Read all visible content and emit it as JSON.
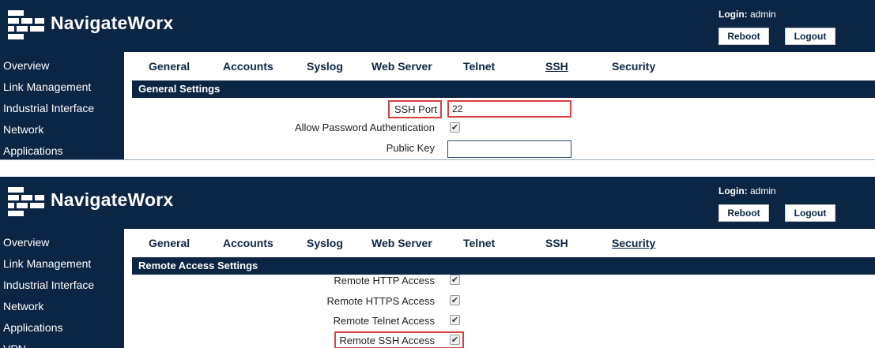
{
  "brand": "NavigateWorx",
  "login": {
    "label": "Login:",
    "user": "admin"
  },
  "buttons": {
    "reboot": "Reboot",
    "logout": "Logout"
  },
  "colors": {
    "navy": "#0b2545",
    "highlight": "#d84040"
  },
  "panel1": {
    "sidebar": [
      "Overview",
      "Link Management",
      "Industrial Interface",
      "Network",
      "Applications"
    ],
    "tabs": [
      "General",
      "Accounts",
      "Syslog",
      "Web Server",
      "Telnet",
      "SSH",
      "Security"
    ],
    "active_tab": "SSH",
    "section_title": "General Settings",
    "fields": {
      "ssh_port_label": "SSH Port",
      "ssh_port_value": "22",
      "allow_password_label": "Allow Password Authentication",
      "allow_password_checked": true,
      "public_key_label": "Public Key",
      "public_key_value": ""
    }
  },
  "panel2": {
    "sidebar": [
      "Overview",
      "Link Management",
      "Industrial Interface",
      "Network",
      "Applications",
      "VPN"
    ],
    "tabs": [
      "General",
      "Accounts",
      "Syslog",
      "Web Server",
      "Telnet",
      "SSH",
      "Security"
    ],
    "active_tab": "Security",
    "section_title": "Remote Access Settings",
    "fields": {
      "http_label": "Remote HTTP Access",
      "https_label": "Remote HTTPS Access",
      "telnet_label": "Remote Telnet Access",
      "ssh_label": "Remote SSH Access",
      "http_checked": true,
      "https_checked": true,
      "telnet_checked": true,
      "ssh_checked": true
    }
  }
}
